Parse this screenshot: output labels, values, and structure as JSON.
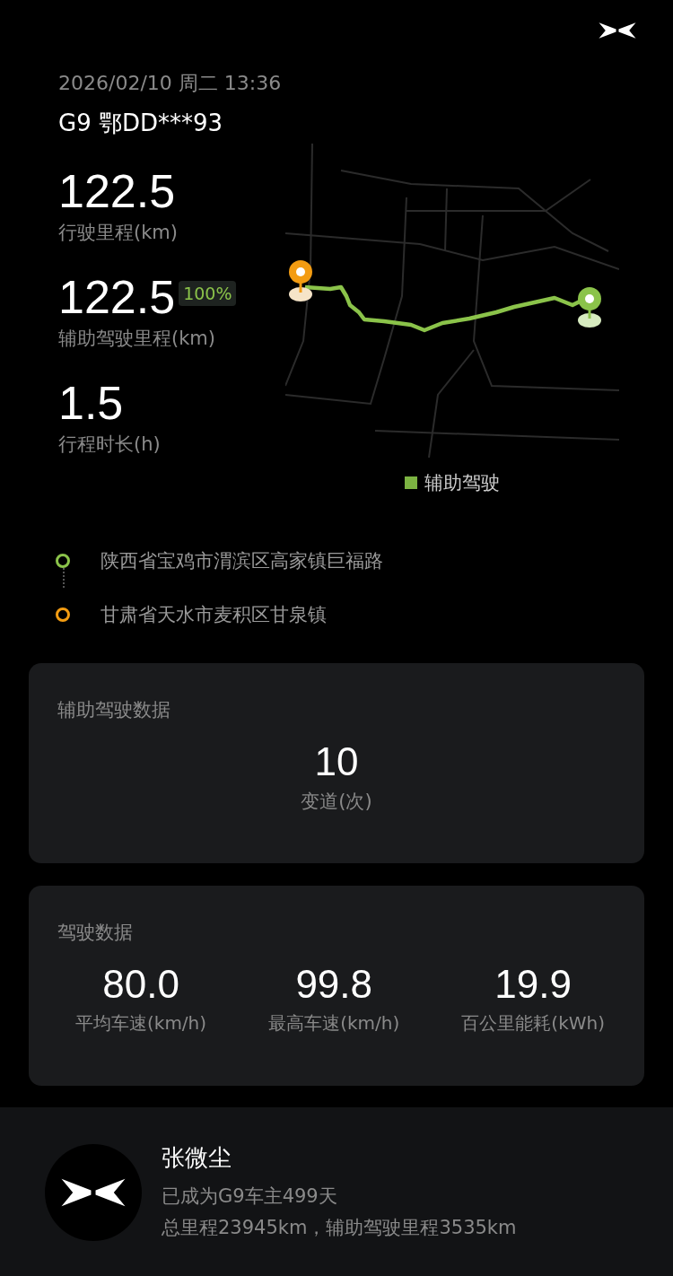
{
  "header": {
    "datetime": "2026/02/10 周二 13:36",
    "vehicle": "G9 鄂DD***93"
  },
  "stats": [
    {
      "value": "122.5",
      "label": "行驶里程(km)"
    },
    {
      "value": "122.5",
      "label": "辅助驾驶里程(km)",
      "badge": "100%"
    },
    {
      "value": "1.5",
      "label": "行程时长(h)"
    }
  ],
  "map": {
    "legend": {
      "label": "辅助驾驶",
      "color": "#7cb342"
    }
  },
  "route": [
    {
      "place": "陕西省宝鸡市渭滨区高家镇巨福路",
      "color": "#8bc34a"
    },
    {
      "place": "甘肃省天水市麦积区甘泉镇",
      "color": "#f39c12"
    }
  ],
  "assist_card": {
    "title": "辅助驾驶数据",
    "metrics": [
      {
        "value": "10",
        "label": "变道(次)"
      }
    ]
  },
  "drive_card": {
    "title": "驾驶数据",
    "metrics": [
      {
        "value": "80.0",
        "label": "平均车速(km/h)"
      },
      {
        "value": "99.8",
        "label": "最高车速(km/h)"
      },
      {
        "value": "19.9",
        "label": "百公里能耗(kWh)"
      }
    ]
  },
  "owner": {
    "name": "张微尘",
    "since": "已成为G9车主499天",
    "totals": "总里程23945km，辅助驾驶里程3535km"
  }
}
